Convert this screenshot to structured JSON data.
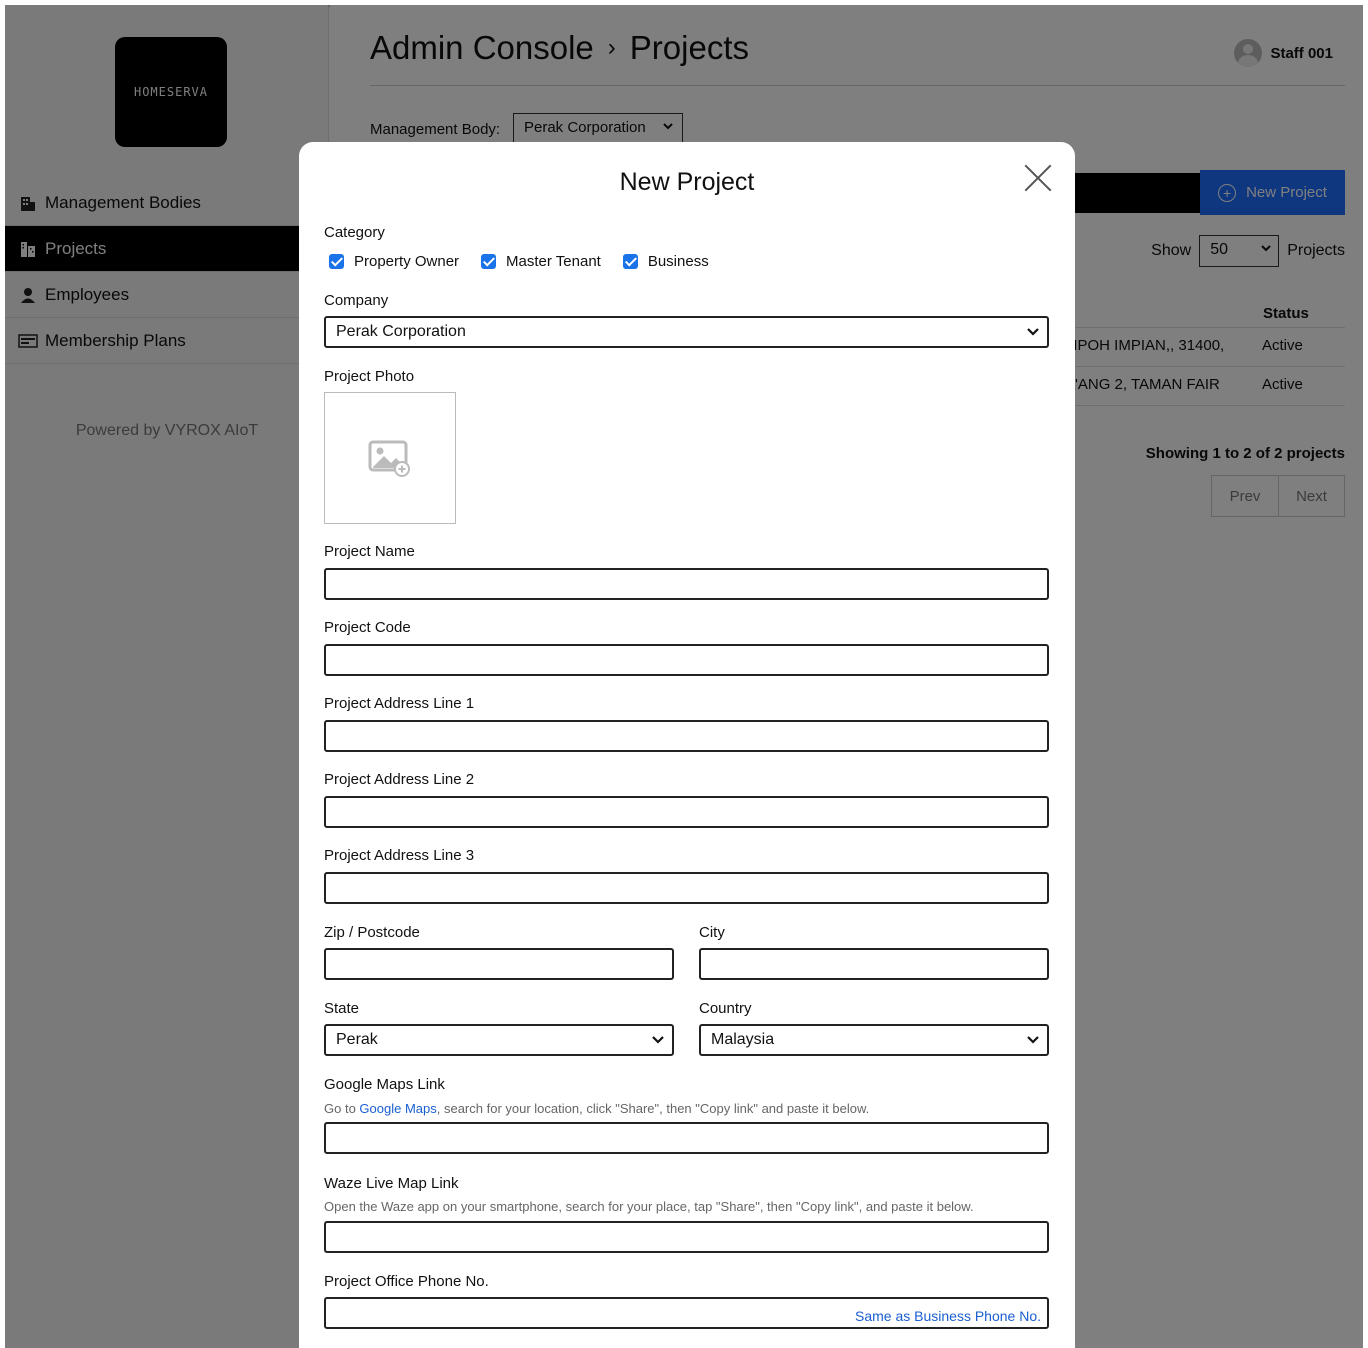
{
  "app": {
    "logo_text": "HOMESERVA",
    "title_section": "Admin Console",
    "title_separator": "›",
    "title_page": "Projects",
    "staff_name": "Staff 001"
  },
  "sidebar": {
    "items": [
      {
        "label": "Management Bodies",
        "icon": "building-icon"
      },
      {
        "label": "Projects",
        "icon": "city-icon"
      },
      {
        "label": "Employees",
        "icon": "person-icon"
      },
      {
        "label": "Membership Plans",
        "icon": "card-icon"
      }
    ],
    "powered_by": "Powered by VYROX AIoT"
  },
  "main": {
    "management_body_label": "Management Body:",
    "management_body_value": "Perak Corporation",
    "new_project_label": "New Project",
    "show_label": "Show",
    "show_value": "50",
    "show_suffix": "Projects",
    "status_header": "Status",
    "rows": [
      {
        "address": "I IPOH IMPIAN,, 31400,",
        "status": "Active"
      },
      {
        "address": "'ANG 2, TAMAN FAIR",
        "status": "Active"
      }
    ],
    "showing": "Showing 1 to 2 of 2 projects",
    "prev": "Prev",
    "next": "Next"
  },
  "modal": {
    "title": "New Project",
    "category_label": "Category",
    "categories": [
      {
        "label": "Property Owner",
        "checked": true
      },
      {
        "label": "Master Tenant",
        "checked": true
      },
      {
        "label": "Business",
        "checked": true
      }
    ],
    "company_label": "Company",
    "company_value": "Perak Corporation",
    "photo_label": "Project Photo",
    "project_name_label": "Project Name",
    "project_name_value": "",
    "project_code_label": "Project Code",
    "project_code_value": "",
    "address1_label": "Project Address Line 1",
    "address1_value": "",
    "address2_label": "Project Address Line 2",
    "address2_value": "",
    "address3_label": "Project Address Line 3",
    "address3_value": "",
    "zip_label": "Zip / Postcode",
    "zip_value": "",
    "city_label": "City",
    "city_value": "",
    "state_label": "State",
    "state_value": "Perak",
    "country_label": "Country",
    "country_value": "Malaysia",
    "gmaps_label": "Google Maps Link",
    "gmaps_hint_pre": "Go to ",
    "gmaps_hint_link": "Google Maps",
    "gmaps_hint_post": ", search for your location, click \"Share\", then \"Copy link\" and paste it below.",
    "gmaps_value": "",
    "waze_label": "Waze Live Map Link",
    "waze_hint": "Open the Waze app on your smartphone, search for your place, tap \"Share\", then \"Copy link\", and paste it below.",
    "waze_value": "",
    "phone_label": "Project Office Phone No.",
    "phone_value": "",
    "same_as_label": "Same as Business Phone No."
  },
  "colors": {
    "accent": "#1e6fff",
    "checkbox": "#1a73e8",
    "link": "#1a5fd1"
  }
}
